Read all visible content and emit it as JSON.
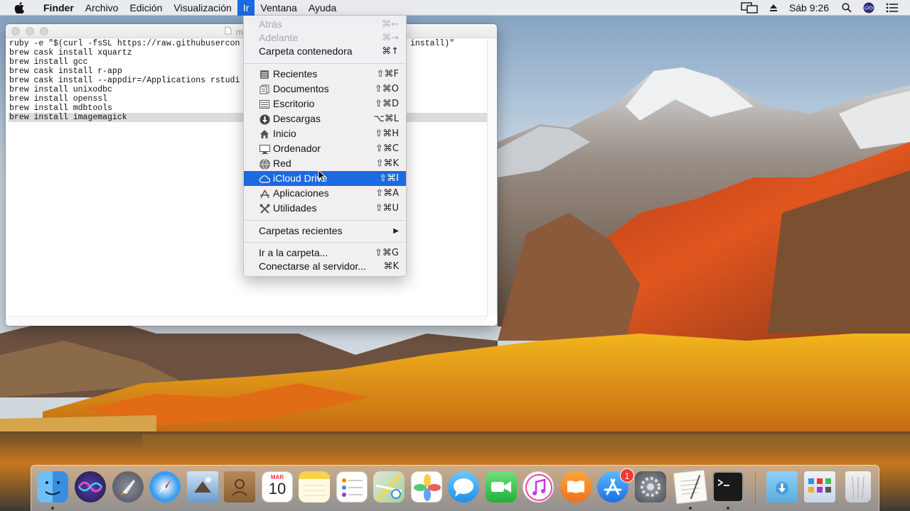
{
  "menubar": {
    "app_name": "Finder",
    "items": [
      "Archivo",
      "Edición",
      "Visualización",
      "Ir",
      "Ventana",
      "Ayuda"
    ],
    "active_item": "Ir",
    "clock": "Sáb 9:26"
  },
  "editor_window": {
    "title": "m",
    "lines": [
      "ruby -e \"$(curl -fsSL https://raw.githubusercon",
      "brew cask install xquartz",
      "brew install gcc",
      "brew cask install r-app",
      "brew cask install --appdir=/Applications rstudi",
      "brew install unixodbc",
      "brew install openssl",
      "brew install mdbtools",
      "brew install imagemagick"
    ],
    "line0_tail": "install)\"",
    "selected_line": "brew install imagemagick"
  },
  "go_menu": {
    "back": {
      "label": "Atrás",
      "shortcut": "⌘←"
    },
    "forward": {
      "label": "Adelante",
      "shortcut": "⌘→"
    },
    "enclosing": {
      "label": "Carpeta contenedora",
      "shortcut": "⌘↑"
    },
    "places": [
      {
        "label": "Recientes",
        "shortcut": "⇧⌘F",
        "icon": "recents-icon"
      },
      {
        "label": "Documentos",
        "shortcut": "⇧⌘O",
        "icon": "documents-icon"
      },
      {
        "label": "Escritorio",
        "shortcut": "⇧⌘D",
        "icon": "desktop-icon"
      },
      {
        "label": "Descargas",
        "shortcut": "⌥⌘L",
        "icon": "downloads-icon"
      },
      {
        "label": "Inicio",
        "shortcut": "⇧⌘H",
        "icon": "home-icon"
      },
      {
        "label": "Ordenador",
        "shortcut": "⇧⌘C",
        "icon": "computer-icon"
      },
      {
        "label": "Red",
        "shortcut": "⇧⌘K",
        "icon": "network-icon"
      },
      {
        "label": "iCloud Drive",
        "shortcut": "⇧⌘I",
        "icon": "icloud-icon"
      },
      {
        "label": "Aplicaciones",
        "shortcut": "⇧⌘A",
        "icon": "applications-icon"
      },
      {
        "label": "Utilidades",
        "shortcut": "⇧⌘U",
        "icon": "utilities-icon"
      }
    ],
    "highlighted": "iCloud Drive",
    "recent_folders": {
      "label": "Carpetas recientes",
      "shortcut": "▶"
    },
    "goto_folder": {
      "label": "Ir a la carpeta...",
      "shortcut": "⇧⌘G"
    },
    "connect_server": {
      "label": "Conectarse al servidor...",
      "shortcut": "⌘K"
    }
  },
  "dock": {
    "calendar_month": "MAR",
    "calendar_day": "10",
    "app_store_badge": "1",
    "colors": {
      "accent": "#1b6ae0"
    }
  }
}
